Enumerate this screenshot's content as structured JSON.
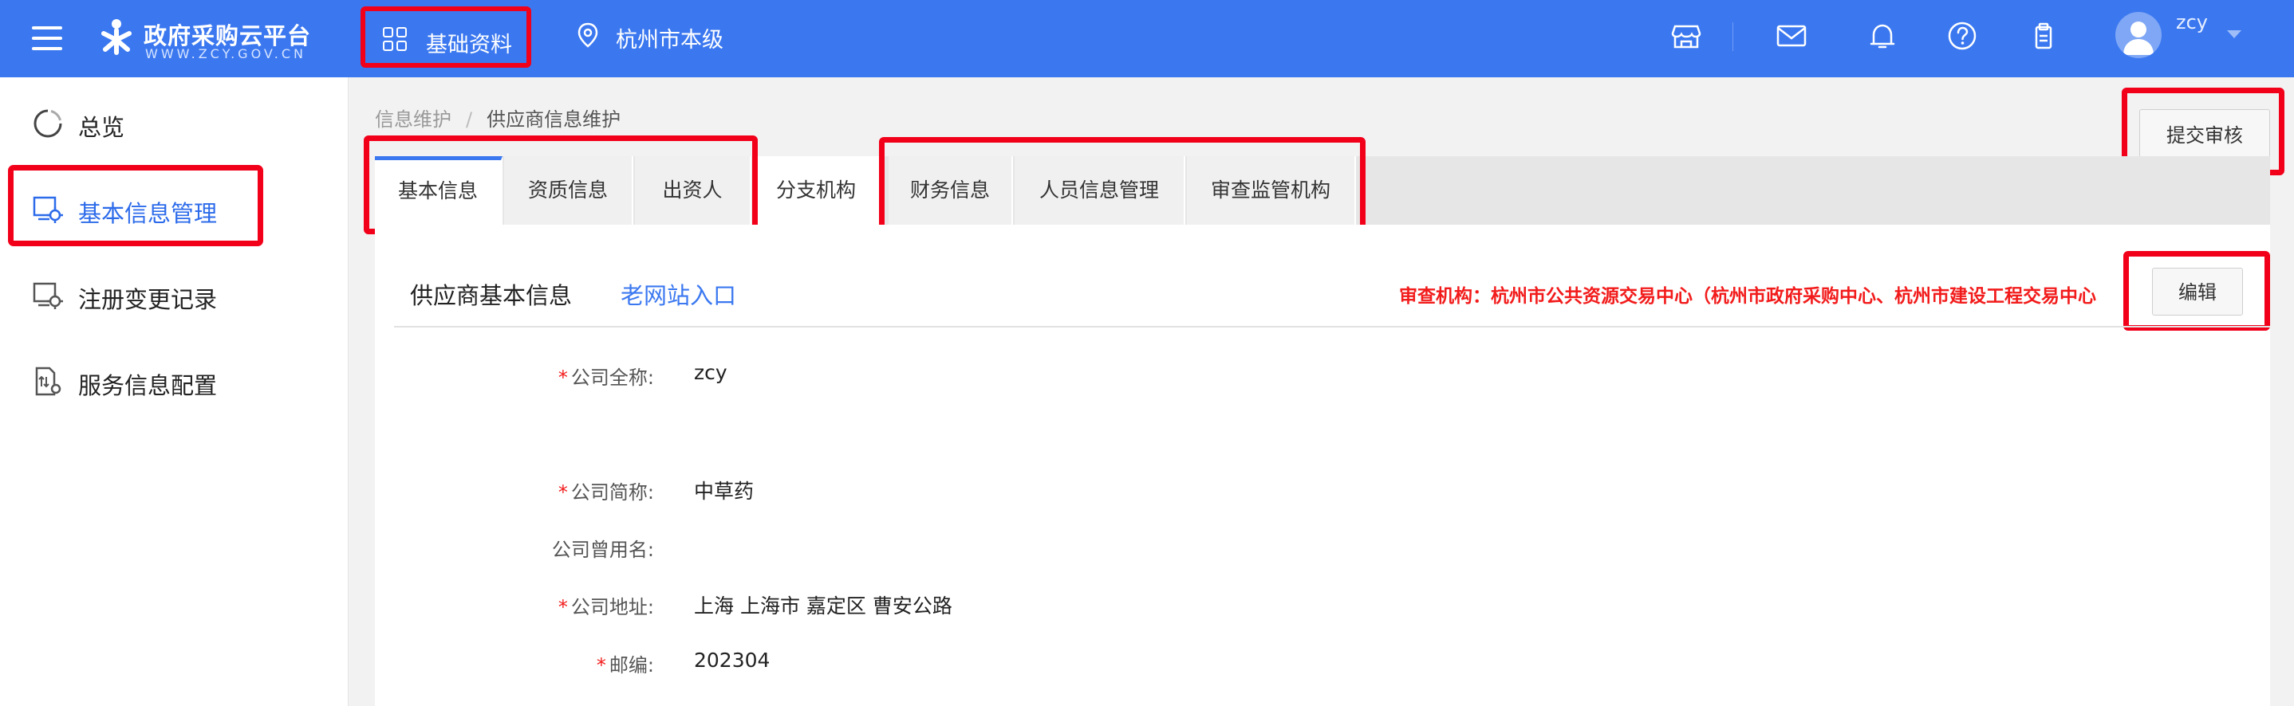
{
  "header": {
    "logo_title": "政府采购云平台",
    "logo_subtitle": "WWW.ZCY.GOV.CN",
    "nav_basic": "基础资料",
    "nav_region": "杭州市本级",
    "user_name": "zcy",
    "icons": [
      "store-icon",
      "mail-icon",
      "bell-icon",
      "help-icon",
      "clipboard-icon"
    ],
    "brand_color": "#3b78f0",
    "highlight_color": "#f2001a"
  },
  "sidebar": {
    "items": [
      {
        "label": "总览",
        "icon": "overview-icon"
      },
      {
        "label": "基本信息管理",
        "icon": "info-settings-icon",
        "active": true
      },
      {
        "label": "注册变更记录",
        "icon": "change-record-icon"
      },
      {
        "label": "服务信息配置",
        "icon": "service-config-icon"
      }
    ]
  },
  "breadcrumb": {
    "parent": "信息维护",
    "separator": "/",
    "current": "供应商信息维护"
  },
  "actions": {
    "submit_review": "提交审核",
    "edit": "编辑"
  },
  "tabs": [
    {
      "label": "基本信息",
      "active": true
    },
    {
      "label": "资质信息"
    },
    {
      "label": "出资人"
    },
    {
      "label": "分支机构"
    },
    {
      "label": "财务信息"
    },
    {
      "label": "人员信息管理"
    },
    {
      "label": "审查监管机构"
    }
  ],
  "panel": {
    "title": "供应商基本信息",
    "old_site_link": "老网站入口",
    "audit_org": "审查机构：杭州市公共资源交易中心（杭州市政府采购中心、杭州市建设工程交易中心"
  },
  "fields": [
    {
      "label": "公司全称:",
      "value": "zcy",
      "required": true
    },
    {
      "label": "公司简称:",
      "value": "中草药",
      "required": true
    },
    {
      "label": "公司曾用名:",
      "value": "",
      "required": false
    },
    {
      "label": "公司地址:",
      "value": "上海 上海市 嘉定区 曹安公路",
      "required": true
    },
    {
      "label": "邮编:",
      "value": "202304",
      "required": true
    }
  ]
}
